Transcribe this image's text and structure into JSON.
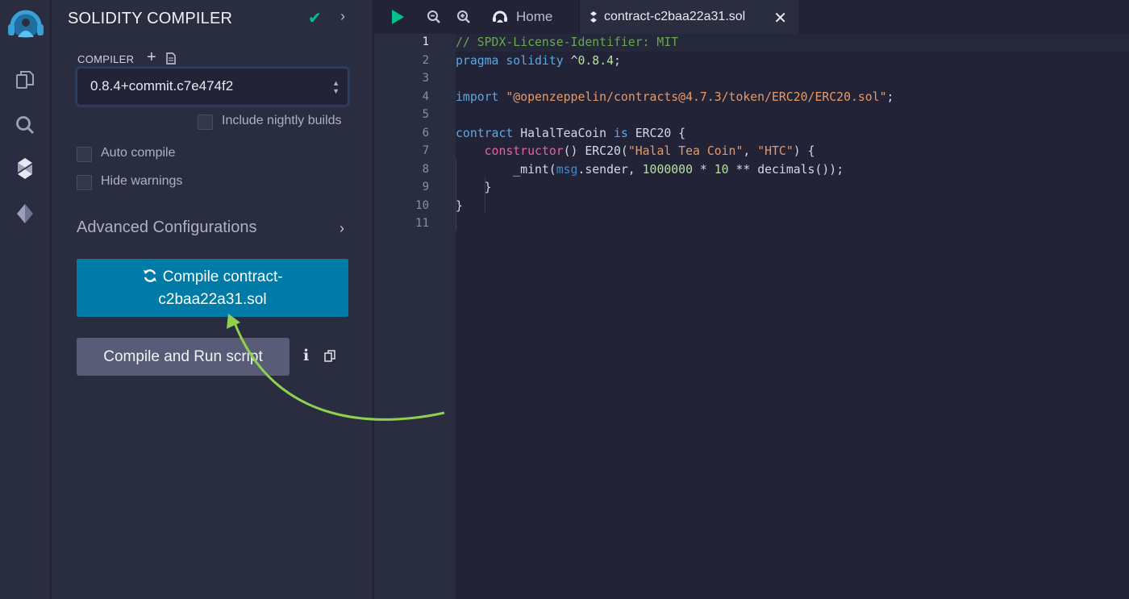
{
  "sidebar_icons": [
    "remix-logo-icon",
    "file-explorer-icon",
    "search-icon",
    "solidity-compiler-icon",
    "deploy-run-icon"
  ],
  "panel": {
    "title": "SOLIDITY COMPILER",
    "compiler_label": "COMPILER",
    "compiler_version": "0.8.4+commit.c7e474f2",
    "nightly_label": "Include nightly builds",
    "auto_compile_label": "Auto compile",
    "hide_warnings_label": "Hide warnings",
    "advanced_label": "Advanced Configurations",
    "compile_button_line1": "Compile contract-",
    "compile_button_line2": "c2baa22a31.sol",
    "run_script_label": "Compile and Run script"
  },
  "tabs": {
    "home": "Home",
    "file": "contract-c2baa22a31.sol"
  },
  "editor": {
    "line_numbers": [
      "1",
      "2",
      "3",
      "4",
      "5",
      "6",
      "7",
      "8",
      "9",
      "10",
      "11"
    ]
  },
  "colors": {
    "accent": "#007aa6",
    "check": "#00c28b",
    "arrow": "#8fd14f"
  }
}
